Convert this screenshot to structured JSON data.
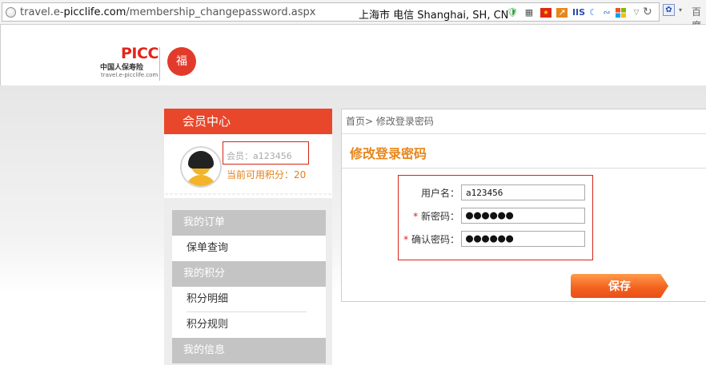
{
  "browser": {
    "url_prefix": "travel.e-",
    "url_domain": "picclife.com",
    "url_path": "/membership_changepassword.aspx",
    "location": "上海市 电信   Shanghai, SH, CN",
    "ext_iis": "IIS",
    "search_mini": "百度"
  },
  "header": {
    "logo_brand": "PICC",
    "logo_company": "中国人保寿险",
    "logo_domain": "travel.e-picclife.com",
    "logo_seal": "福"
  },
  "sidebar": {
    "title": "会员中心",
    "member_label": "会员：a123456",
    "points_label": "当前可用积分：20",
    "menu": [
      {
        "label": "我的订单",
        "type": "group"
      },
      {
        "label": "保单查询",
        "type": "item"
      },
      {
        "label": "我的积分",
        "type": "group"
      },
      {
        "label": "积分明细",
        "type": "item"
      },
      {
        "label": "积分规则",
        "type": "item"
      },
      {
        "label": "我的信息",
        "type": "group"
      }
    ]
  },
  "main": {
    "breadcrumb": "首页> 修改登录密码",
    "title": "修改登录密码",
    "form": {
      "username_label": "用户名：",
      "username_value": "a123456",
      "new_password_label": "新密码：",
      "new_password_value": "●●●●●●",
      "confirm_password_label": "确认密码：",
      "confirm_password_value": "●●●●●●",
      "required_mark": "*"
    },
    "save_label": "保存"
  },
  "colors": {
    "accent_red": "#e8472b",
    "title_orange": "#e8861a",
    "highlight_box": "#d2261b"
  }
}
